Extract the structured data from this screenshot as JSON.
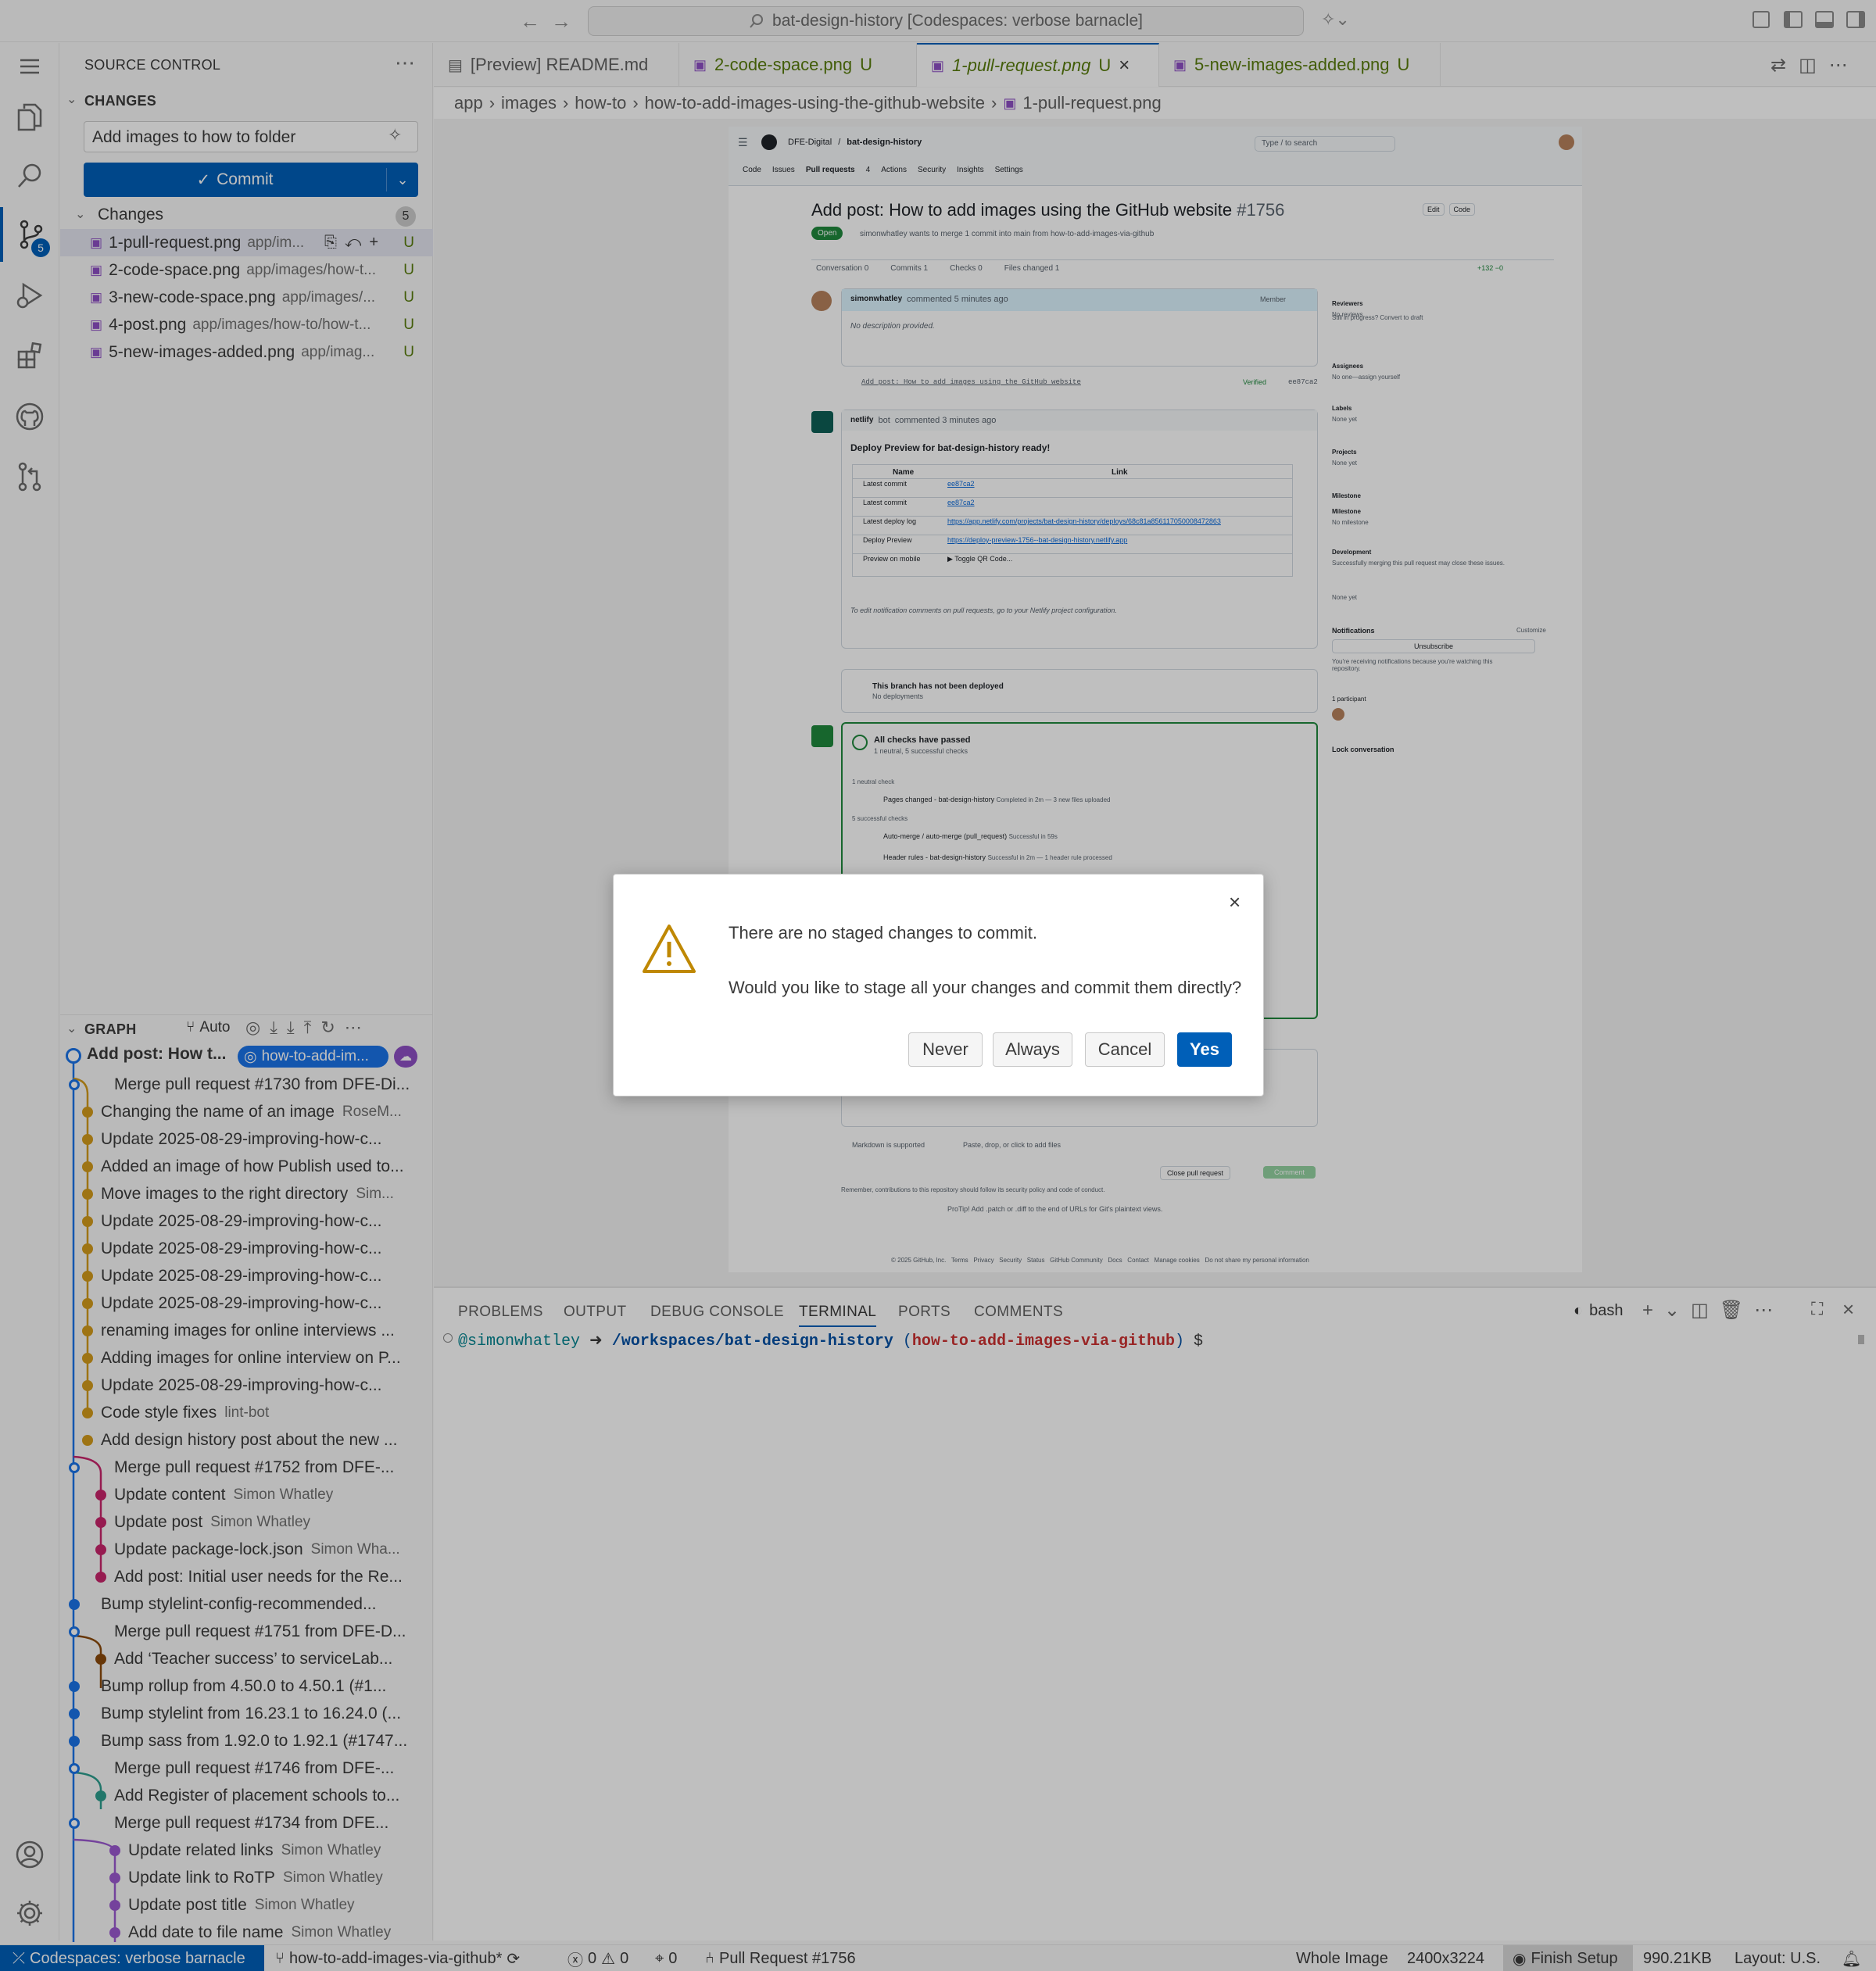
{
  "titlebar": {
    "command_center": "bat-design-history [Codespaces: verbose barnacle]"
  },
  "sidebar": {
    "title": "SOURCE CONTROL",
    "changes_section": "CHANGES",
    "commit_message": "Add images to how to folder",
    "commit_label": "Commit",
    "changes_group": "Changes",
    "changes_count": "5",
    "files": [
      {
        "name": "1-pull-request.png",
        "path": "app/im...",
        "status": "U"
      },
      {
        "name": "2-code-space.png",
        "path": "app/images/how-t...",
        "status": "U"
      },
      {
        "name": "3-new-code-space.png",
        "path": "app/images/...",
        "status": "U"
      },
      {
        "name": "4-post.png",
        "path": "app/images/how-to/how-t...",
        "status": "U"
      },
      {
        "name": "5-new-images-added.png",
        "path": "app/imag...",
        "status": "U"
      }
    ],
    "graph_title": "GRAPH",
    "graph_auto": "Auto",
    "graph_head": {
      "title": "Add post: How t...",
      "branch": "how-to-add-im..."
    },
    "graph": [
      {
        "msg": "Merge pull request #1730 from DFE-Di...",
        "author": "",
        "color": "#1a73e8"
      },
      {
        "msg": "Changing the name of an image",
        "author": "RoseM...",
        "color": "#d39b1b"
      },
      {
        "msg": "Update 2025-08-29-improving-how-c...",
        "author": "",
        "color": "#d39b1b"
      },
      {
        "msg": "Added an image of how Publish used to...",
        "author": "",
        "color": "#d39b1b"
      },
      {
        "msg": "Move images to the right directory",
        "author": "Sim...",
        "color": "#d39b1b"
      },
      {
        "msg": "Update 2025-08-29-improving-how-c...",
        "author": "",
        "color": "#d39b1b"
      },
      {
        "msg": "Update 2025-08-29-improving-how-c...",
        "author": "",
        "color": "#d39b1b"
      },
      {
        "msg": "Update 2025-08-29-improving-how-c...",
        "author": "",
        "color": "#d39b1b"
      },
      {
        "msg": "Update 2025-08-29-improving-how-c...",
        "author": "",
        "color": "#d39b1b"
      },
      {
        "msg": "renaming images for online interviews ...",
        "author": "",
        "color": "#d39b1b"
      },
      {
        "msg": "Adding images for online interview on P...",
        "author": "",
        "color": "#d39b1b"
      },
      {
        "msg": "Update 2025-08-29-improving-how-c...",
        "author": "",
        "color": "#d39b1b"
      },
      {
        "msg": "Code style fixes",
        "author": "lint-bot",
        "color": "#d39b1b"
      },
      {
        "msg": "Add design history post about the new ...",
        "author": "",
        "color": "#d39b1b"
      },
      {
        "msg": "Merge pull request #1752 from DFE-...",
        "author": "",
        "color": "#1a73e8"
      },
      {
        "msg": "Update content",
        "author": "Simon Whatley",
        "color": "#c8246b"
      },
      {
        "msg": "Update post",
        "author": "Simon Whatley",
        "color": "#c8246b"
      },
      {
        "msg": "Update package-lock.json",
        "author": "Simon Wha...",
        "color": "#c8246b"
      },
      {
        "msg": "Add post: Initial user needs for the Re...",
        "author": "",
        "color": "#c8246b"
      },
      {
        "msg": "Bump stylelint-config-recommended...",
        "author": "",
        "color": "#1a73e8"
      },
      {
        "msg": "Merge pull request #1751 from DFE-D...",
        "author": "",
        "color": "#1a73e8"
      },
      {
        "msg": "Add ‘Teacher success’ to serviceLab...",
        "author": "",
        "color": "#8b4a0b"
      },
      {
        "msg": "Bump rollup from 4.50.0 to 4.50.1 (#1...",
        "author": "",
        "color": "#1a73e8"
      },
      {
        "msg": "Bump stylelint from 16.23.1 to 16.24.0 (...",
        "author": "",
        "color": "#1a73e8"
      },
      {
        "msg": "Bump sass from 1.92.0 to 1.92.1 (#1747...",
        "author": "",
        "color": "#1a73e8"
      },
      {
        "msg": "Merge pull request #1746 from DFE-...",
        "author": "",
        "color": "#1a73e8"
      },
      {
        "msg": "Add Register of placement schools to...",
        "author": "",
        "color": "#2c9e8e"
      },
      {
        "msg": "Merge pull request #1734 from DFE...",
        "author": "",
        "color": "#1a73e8"
      },
      {
        "msg": "Update related links",
        "author": "Simon Whatley",
        "color": "#9b59d0"
      },
      {
        "msg": "Update link to RoTP",
        "author": "Simon Whatley",
        "color": "#9b59d0"
      },
      {
        "msg": "Update post title",
        "author": "Simon Whatley",
        "color": "#9b59d0"
      },
      {
        "msg": "Add date to file name",
        "author": "Simon Whatley",
        "color": "#9b59d0"
      }
    ]
  },
  "tabs": [
    {
      "label": "[Preview] README.md",
      "status": ""
    },
    {
      "label": "2-code-space.png",
      "status": "U"
    },
    {
      "label": "1-pull-request.png",
      "status": "U"
    },
    {
      "label": "5-new-images-added.png",
      "status": "U"
    }
  ],
  "breadcrumb": [
    "app",
    "images",
    "how-to",
    "how-to-add-images-using-the-github-website",
    "1-pull-request.png"
  ],
  "screenshot": {
    "org": "DFE-Digital",
    "repo": "bat-design-history",
    "search": "Type / to search",
    "nav": [
      "Code",
      "Issues",
      "Pull requests",
      "4",
      "Actions",
      "Security",
      "Insights",
      "Settings"
    ],
    "pr_title": "Add post: How to add images using the GitHub website",
    "pr_number": "#1756",
    "open": "Open",
    "meta": "simonwhatley wants to merge 1 commit into main from how-to-add-images-via-github",
    "edit": "Edit",
    "code": "Code",
    "subtabs": [
      "Conversation 0",
      "Commits 1",
      "Checks 0",
      "Files changed 1"
    ],
    "diffstat": "+132 −0",
    "comment_author": "simonwhatley",
    "comment_meta": "commented 5 minutes ago",
    "member": "Member",
    "no_desc": "No description provided.",
    "commit_line": "Add post: How to add images using the GitHub website",
    "verified": "Verified",
    "sha": "ee87ca2",
    "netlify": "netlify",
    "bot": "bot",
    "netlify_meta": "commented 3 minutes ago",
    "deploy_title": "Deploy Preview for bat-design-history ready!",
    "table_name": "Name",
    "table_link": "Link",
    "rows": [
      {
        "name": "Latest commit",
        "link": "ee87ca2"
      },
      {
        "name": "Latest commit",
        "link": "ee87ca2"
      },
      {
        "name": "Latest deploy log",
        "link": "https://app.netlify.com/projects/bat-design-history/deploys/68c81a856117050008472863"
      },
      {
        "name": "Deploy Preview",
        "link": "https://deploy-preview-1756--bat-design-history.netlify.app"
      },
      {
        "name": "Preview on mobile",
        "link": "▶ Toggle QR Code..."
      }
    ],
    "notif": "To edit notification comments on pull requests, go to your Netlify project configuration.",
    "not_deployed": "This branch has not been deployed",
    "no_deployments": "No deployments",
    "checks_title": "All checks have passed",
    "checks_sub": "1 neutral, 5 successful checks",
    "neutral_check": "1 neutral check",
    "check1": "Pages changed - bat-design-history",
    "check1_meta": "Completed in 2m — 3 new files uploaded",
    "successful": "5 successful checks",
    "check2": "Auto-merge / auto-merge (pull_request)",
    "check2_meta": "Successful in 59s",
    "check3": "Header rules - bat-design-history",
    "check3_meta": "Successful in 2m — 1 header rule processed",
    "markdown": "Markdown is supported",
    "paste": "Paste, drop, or click to add files",
    "close_pr": "Close pull request",
    "comment": "Comment",
    "remember": "Remember, contributions to this repository should follow its security policy and code of conduct.",
    "protip": "ProTip! Add .patch or .diff to the end of URLs for Git's plaintext views.",
    "footer": "© 2025 GitHub, Inc.   Terms   Privacy   Security   Status   GitHub Community   Docs   Contact   Manage cookies   Do not share my personal information",
    "side": [
      {
        "title": "Reviewers",
        "value": "No reviews"
      },
      {
        "title": "",
        "value": "Still in progress? Convert to draft"
      },
      {
        "title": "Assignees",
        "value": "No one—assign yourself"
      },
      {
        "title": "Labels",
        "value": "None yet"
      },
      {
        "title": "Projects",
        "value": "None yet"
      },
      {
        "title": "Milestone",
        "value": ""
      },
      {
        "title": "Milestone",
        "value": "No milestone"
      },
      {
        "title": "Development",
        "value": "Successfully merging this pull request may close these issues."
      },
      {
        "title": "",
        "value": "None yet"
      }
    ],
    "notifications": "Notifications",
    "customize": "Customize",
    "unsubscribe": "Unsubscribe",
    "receiving": "You're receiving notifications because you're watching this repository.",
    "participants": "1 participant",
    "lock": "Lock conversation"
  },
  "dialog": {
    "message": "There are no staged changes to commit.",
    "detail": "Would you like to stage all your changes and commit them directly?",
    "never": "Never",
    "always": "Always",
    "cancel": "Cancel",
    "yes": "Yes"
  },
  "panel": {
    "tabs": [
      "PROBLEMS",
      "OUTPUT",
      "DEBUG CONSOLE",
      "TERMINAL",
      "PORTS",
      "COMMENTS"
    ],
    "shell": "bash",
    "prompt_user": "@simonwhatley",
    "prompt_arrow": "➜",
    "prompt_path": "/workspaces/bat-design-history",
    "prompt_branch_open": "(",
    "prompt_branch": "how-to-add-images-via-github",
    "prompt_branch_close": ")",
    "prompt_dollar": "$"
  },
  "statusbar": {
    "remote": "Codespaces: verbose barnacle",
    "branch": "how-to-add-images-via-github*",
    "errors": "0",
    "warnings": "0",
    "ports": "0",
    "pr": "Pull Request #1756",
    "image_mode": "Whole Image",
    "dimensions": "2400x3224",
    "finish": "Finish Setup",
    "size": "990.21KB",
    "layout": "Layout: U.S."
  },
  "colors": {
    "accent": "#005fb8",
    "untracked": "#587c0c",
    "remote": "#005fb8"
  }
}
